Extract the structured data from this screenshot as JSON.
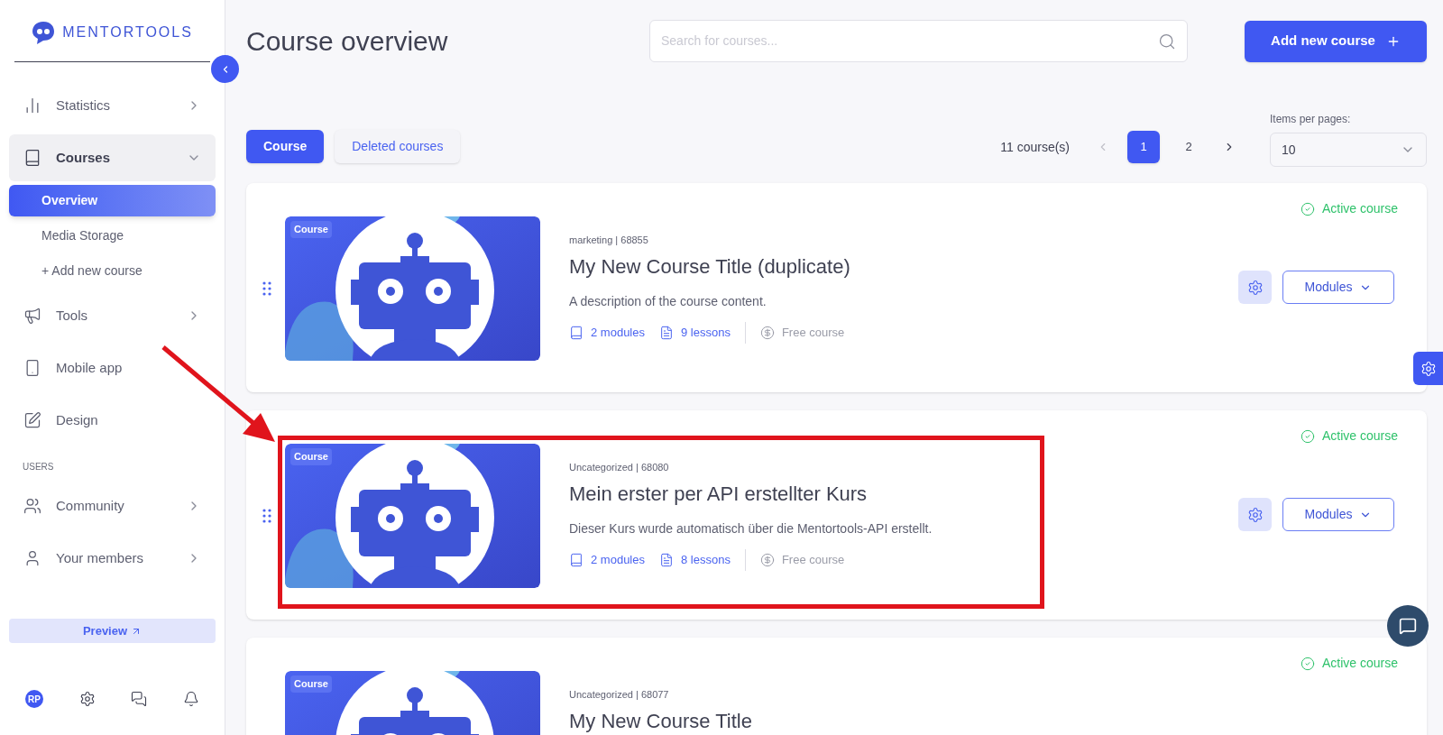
{
  "sidebar": {
    "logo": "MENTORTOOLS",
    "nav": [
      {
        "label": "Statistics",
        "expanded": false
      },
      {
        "label": "Courses",
        "expanded": true,
        "children": [
          {
            "label": "Overview",
            "selected": true
          },
          {
            "label": "Media Storage",
            "selected": false
          },
          {
            "label": "+ Add new course",
            "selected": false
          }
        ]
      },
      {
        "label": "Tools",
        "expanded": false
      },
      {
        "label": "Mobile app"
      },
      {
        "label": "Design"
      }
    ],
    "users_section": {
      "heading": "USERS",
      "nav": [
        {
          "label": "Community",
          "expanded": false
        },
        {
          "label": "Your members",
          "expanded": false
        }
      ]
    },
    "preview_button": "Preview",
    "avatar": "RP"
  },
  "header": {
    "title": "Course overview",
    "search": {
      "placeholder": "Search for courses..."
    },
    "add_button": "Add new course"
  },
  "tabs": [
    {
      "label": "Course",
      "selected": true
    },
    {
      "label": "Deleted courses",
      "selected": false
    }
  ],
  "pagination": {
    "count": "11 course(s)",
    "pages": [
      {
        "label": "1",
        "selected": true
      },
      {
        "label": "2",
        "selected": false
      }
    ],
    "items_per_page": {
      "label": "Items per pages:",
      "value": "10"
    }
  },
  "courses": [
    {
      "badge": "Course",
      "meta": "marketing | 68855",
      "title": "My New Course Title (duplicate)",
      "description": "A description of the course content.",
      "modules": "2 modules",
      "lessons": "9 lessons",
      "price": "Free course",
      "status": "Active course",
      "modules_button": "Modules",
      "annotated": false
    },
    {
      "badge": "Course",
      "meta": "Uncategorized | 68080",
      "title": "Mein erster per API erstellter Kurs",
      "description": "Dieser Kurs wurde automatisch über die Mentortools-API erstellt.",
      "modules": "2 modules",
      "lessons": "8 lessons",
      "price": "Free course",
      "status": "Active course",
      "modules_button": "Modules",
      "annotated": true
    },
    {
      "badge": "Course",
      "meta": "Uncategorized | 68077",
      "title": "My New Course Title",
      "status": "Active course"
    }
  ]
}
